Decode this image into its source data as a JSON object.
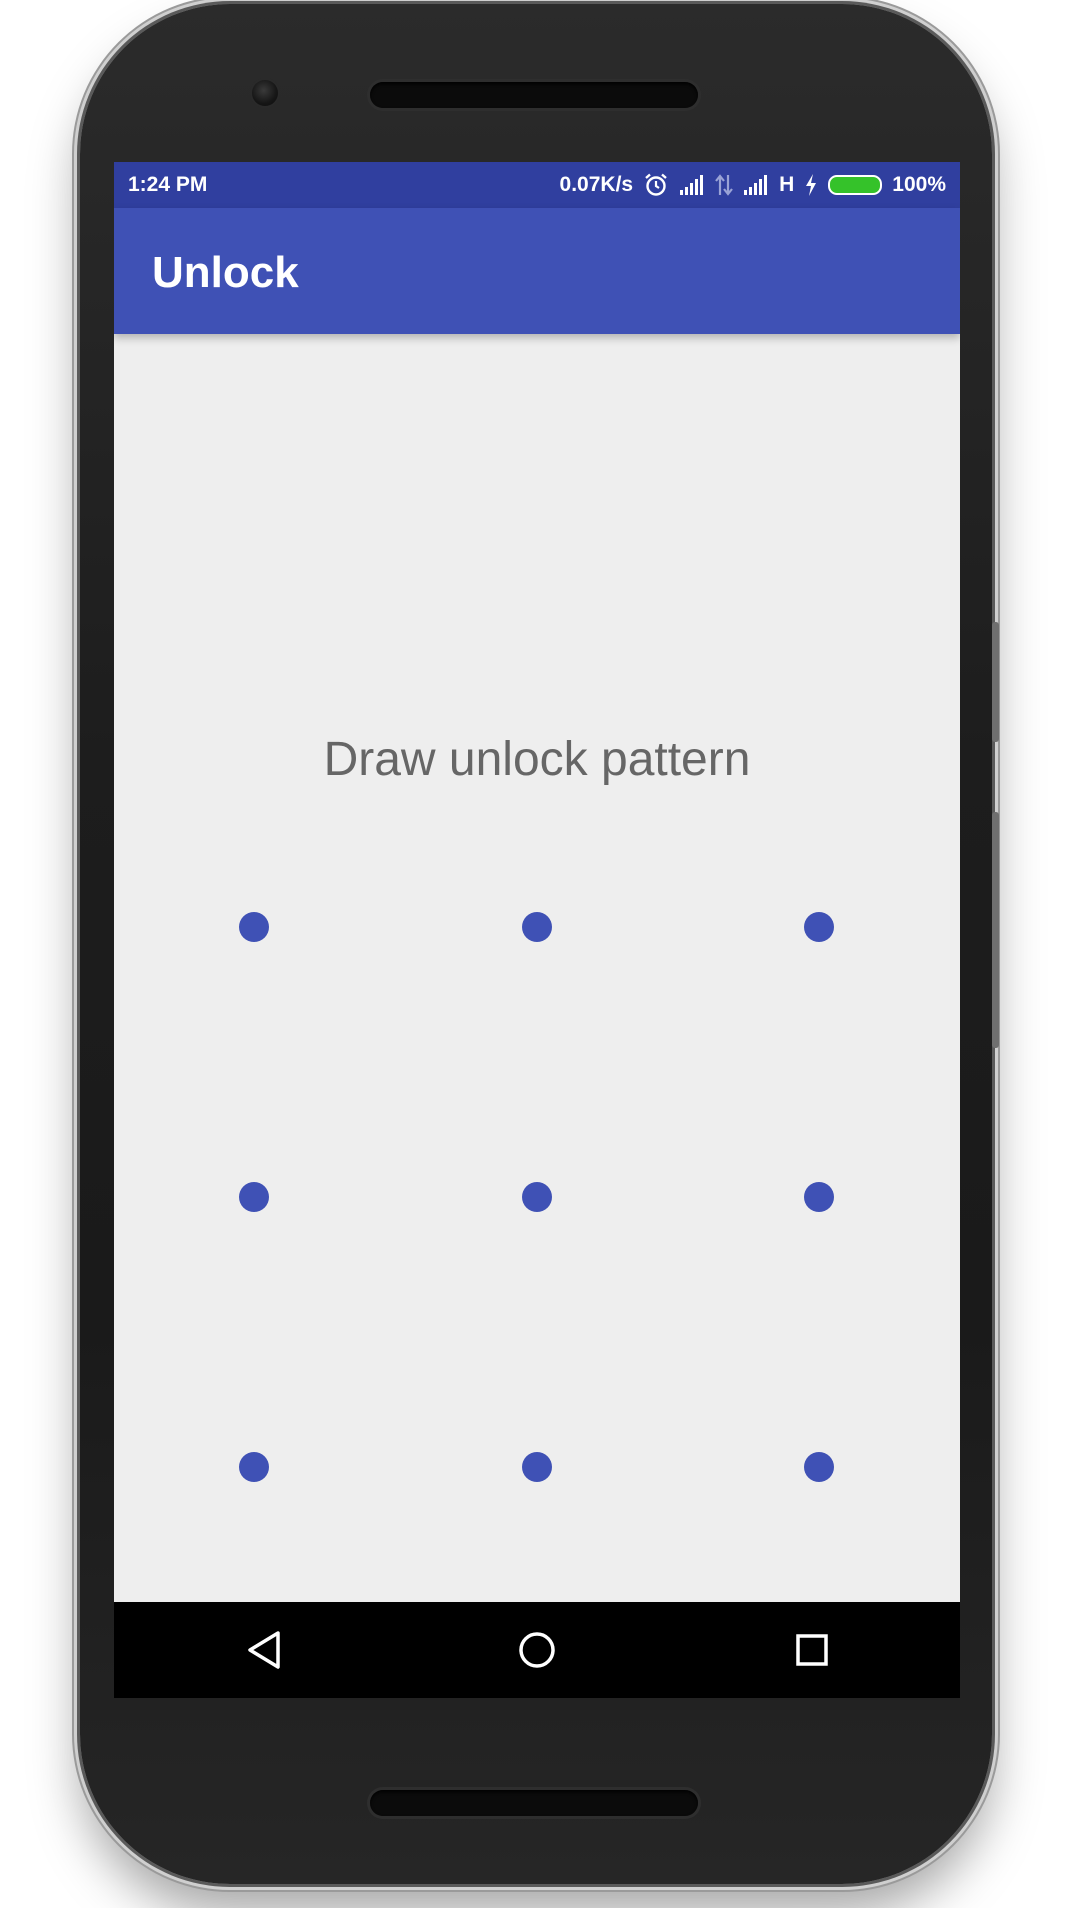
{
  "colors": {
    "status_bar": "#303f9f",
    "app_bar": "#3f51b5",
    "pattern_dot": "#3f51b5",
    "background": "#eeeeee",
    "prompt_text": "#666666",
    "battery_fill": "#35c22a"
  },
  "status_bar": {
    "time": "1:24 PM",
    "net_speed": "0.07K/s",
    "network_type": "H",
    "battery_level": "100%",
    "icons": [
      "alarm-icon",
      "signal-icon",
      "data-arrows-icon",
      "signal-icon",
      "charging-icon",
      "battery-icon"
    ]
  },
  "app_bar": {
    "title": "Unlock"
  },
  "pattern": {
    "prompt": "Draw unlock pattern",
    "rows": 3,
    "columns": 3
  },
  "nav_bar": {
    "buttons": [
      "back-icon",
      "home-icon",
      "recents-icon"
    ]
  }
}
